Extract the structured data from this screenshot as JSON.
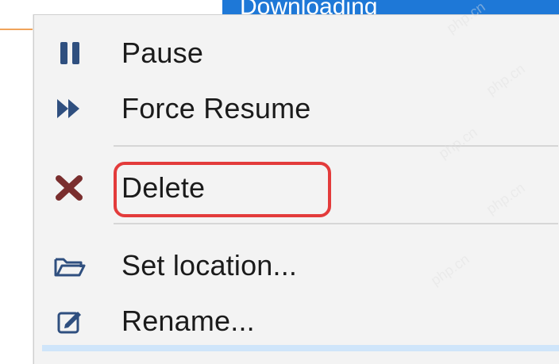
{
  "header": {
    "status_label": "Downloading"
  },
  "menu": {
    "items": [
      {
        "label": "Pause",
        "icon": "pause-icon"
      },
      {
        "label": "Force Resume",
        "icon": "fast-forward-icon"
      },
      {
        "label": "Delete",
        "icon": "delete-x-icon",
        "color": "#7a2e2e"
      },
      {
        "label": "Set location...",
        "icon": "folder-open-icon"
      },
      {
        "label": "Rename...",
        "icon": "rename-icon"
      }
    ]
  },
  "colors": {
    "icon_blue": "#2f4f7f",
    "menu_bg": "#f3f3f3",
    "highlight_blue": "#1e78d7",
    "annotation_red": "#e33b3b"
  },
  "watermark": "php.cn"
}
